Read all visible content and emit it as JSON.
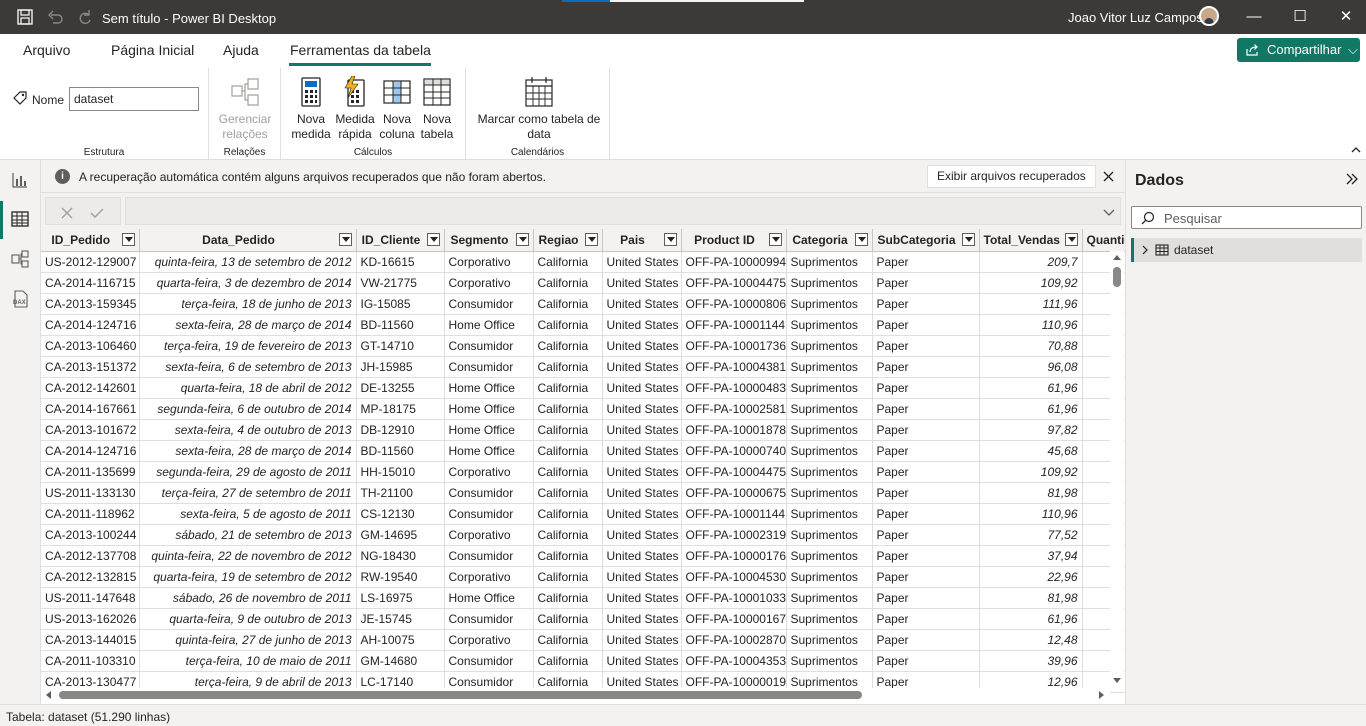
{
  "window": {
    "title": "Sem título - Power BI Desktop",
    "user_name": "Joao Vitor Luz Campos"
  },
  "menu": {
    "items": [
      {
        "label": "Arquivo"
      },
      {
        "label": "Página Inicial"
      },
      {
        "label": "Ajuda"
      },
      {
        "label": "Ferramentas da tabela"
      }
    ],
    "active": "Ferramentas da tabela",
    "share_label": "Compartilhar"
  },
  "ribbon": {
    "name_label": "Nome",
    "name_value": "dataset",
    "groups": {
      "estrutura": "Estrutura",
      "relacoes": "Relações",
      "calculos": "Cálculos",
      "calendarios": "Calendários"
    },
    "buttons": {
      "gerenciar_relacoes": [
        "Gerenciar",
        "relações"
      ],
      "nova_medida": [
        "Nova",
        "medida"
      ],
      "medida_rapida": [
        "Medida",
        "rápida"
      ],
      "nova_coluna": [
        "Nova",
        "coluna"
      ],
      "nova_tabela": [
        "Nova",
        "tabela"
      ],
      "marcar_calendario": [
        "Marcar como tabela de",
        "data"
      ]
    }
  },
  "notification": {
    "message": "A recuperação automática contém alguns arquivos recuperados que não foram abertos.",
    "button_label": "Exibir arquivos recuperados"
  },
  "table": {
    "columns": [
      "ID_Pedido",
      "Data_Pedido",
      "ID_Cliente",
      "Segmento",
      "Regiao",
      "Pais",
      "Product ID",
      "Categoria",
      "SubCategoria",
      "Total_Vendas",
      "Quantidade"
    ],
    "column_header_shown": [
      "ID_Pedido",
      "Data_Pedido",
      "ID_Cliente",
      "Segmento",
      "Regiao",
      "Pais",
      "Product ID",
      "Categoria",
      "SubCategoria",
      "Total_Vendas",
      "Quanti"
    ],
    "rows": [
      [
        "US-2012-129007",
        "quinta-feira, 13 de setembro de 2012",
        "KD-16615",
        "Corporativo",
        "California",
        "United States",
        "OFF-PA-10000994",
        "Suprimentos",
        "Paper",
        "209,7"
      ],
      [
        "CA-2014-116715",
        "quarta-feira, 3 de dezembro de 2014",
        "VW-21775",
        "Corporativo",
        "California",
        "United States",
        "OFF-PA-10004475",
        "Suprimentos",
        "Paper",
        "109,92"
      ],
      [
        "CA-2013-159345",
        "terça-feira, 18 de junho de 2013",
        "IG-15085",
        "Consumidor",
        "California",
        "United States",
        "OFF-PA-10000806",
        "Suprimentos",
        "Paper",
        "111,96"
      ],
      [
        "CA-2014-124716",
        "sexta-feira, 28 de março de 2014",
        "BD-11560",
        "Home Office",
        "California",
        "United States",
        "OFF-PA-10001144",
        "Suprimentos",
        "Paper",
        "110,96"
      ],
      [
        "CA-2013-106460",
        "terça-feira, 19 de fevereiro de 2013",
        "GT-14710",
        "Consumidor",
        "California",
        "United States",
        "OFF-PA-10001736",
        "Suprimentos",
        "Paper",
        "70,88"
      ],
      [
        "CA-2013-151372",
        "sexta-feira, 6 de setembro de 2013",
        "JH-15985",
        "Consumidor",
        "California",
        "United States",
        "OFF-PA-10004381",
        "Suprimentos",
        "Paper",
        "96,08"
      ],
      [
        "CA-2012-142601",
        "quarta-feira, 18 de abril de 2012",
        "DE-13255",
        "Home Office",
        "California",
        "United States",
        "OFF-PA-10000483",
        "Suprimentos",
        "Paper",
        "61,96"
      ],
      [
        "CA-2014-167661",
        "segunda-feira, 6 de outubro de 2014",
        "MP-18175",
        "Home Office",
        "California",
        "United States",
        "OFF-PA-10002581",
        "Suprimentos",
        "Paper",
        "61,96"
      ],
      [
        "CA-2013-101672",
        "sexta-feira, 4 de outubro de 2013",
        "DB-12910",
        "Home Office",
        "California",
        "United States",
        "OFF-PA-10001878",
        "Suprimentos",
        "Paper",
        "97,82"
      ],
      [
        "CA-2014-124716",
        "sexta-feira, 28 de março de 2014",
        "BD-11560",
        "Home Office",
        "California",
        "United States",
        "OFF-PA-10000740",
        "Suprimentos",
        "Paper",
        "45,68"
      ],
      [
        "CA-2011-135699",
        "segunda-feira, 29 de agosto de 2011",
        "HH-15010",
        "Corporativo",
        "California",
        "United States",
        "OFF-PA-10004475",
        "Suprimentos",
        "Paper",
        "109,92"
      ],
      [
        "US-2011-133130",
        "terça-feira, 27 de setembro de 2011",
        "TH-21100",
        "Consumidor",
        "California",
        "United States",
        "OFF-PA-10000675",
        "Suprimentos",
        "Paper",
        "81,98"
      ],
      [
        "CA-2011-118962",
        "sexta-feira, 5 de agosto de 2011",
        "CS-12130",
        "Consumidor",
        "California",
        "United States",
        "OFF-PA-10001144",
        "Suprimentos",
        "Paper",
        "110,96"
      ],
      [
        "CA-2013-100244",
        "sábado, 21 de setembro de 2013",
        "GM-14695",
        "Corporativo",
        "California",
        "United States",
        "OFF-PA-10002319",
        "Suprimentos",
        "Paper",
        "77,52"
      ],
      [
        "CA-2012-137708",
        "quinta-feira, 22 de novembro de 2012",
        "NG-18430",
        "Consumidor",
        "California",
        "United States",
        "OFF-PA-10000176",
        "Suprimentos",
        "Paper",
        "37,94"
      ],
      [
        "CA-2012-132815",
        "quarta-feira, 19 de setembro de 2012",
        "RW-19540",
        "Corporativo",
        "California",
        "United States",
        "OFF-PA-10004530",
        "Suprimentos",
        "Paper",
        "22,96"
      ],
      [
        "US-2011-147648",
        "sábado, 26 de novembro de 2011",
        "LS-16975",
        "Home Office",
        "California",
        "United States",
        "OFF-PA-10001033",
        "Suprimentos",
        "Paper",
        "81,98"
      ],
      [
        "US-2013-162026",
        "quarta-feira, 9 de outubro de 2013",
        "JE-15745",
        "Consumidor",
        "California",
        "United States",
        "OFF-PA-10000167",
        "Suprimentos",
        "Paper",
        "61,96"
      ],
      [
        "CA-2013-144015",
        "quinta-feira, 27 de junho de 2013",
        "AH-10075",
        "Corporativo",
        "California",
        "United States",
        "OFF-PA-10002870",
        "Suprimentos",
        "Paper",
        "12,48"
      ],
      [
        "CA-2011-103310",
        "terça-feira, 10 de maio de 2011",
        "GM-14680",
        "Consumidor",
        "California",
        "United States",
        "OFF-PA-10004353",
        "Suprimentos",
        "Paper",
        "39,96"
      ],
      [
        "CA-2013-130477",
        "terça-feira, 9 de abril de 2013",
        "LC-17140",
        "Consumidor",
        "California",
        "United States",
        "OFF-PA-10000019",
        "Suprimentos",
        "Paper",
        "12,96"
      ]
    ]
  },
  "data_pane": {
    "title": "Dados",
    "search_placeholder": "Pesquisar",
    "items": [
      {
        "label": "dataset"
      }
    ]
  },
  "status": {
    "text": "Tabela: dataset (51.290 linhas)"
  },
  "colors": {
    "accent": "#117865",
    "titlebar": "#3b3a39",
    "panel": "#f3f2f1"
  },
  "icons": {
    "save": "save-icon",
    "undo": "undo-icon",
    "redo": "redo-icon",
    "share": "share-icon",
    "tag": "tag-icon",
    "report_view": "bar-chart-icon",
    "table_view": "table-grid-icon",
    "model_view": "model-icon",
    "dax_view": "dax-icon"
  }
}
